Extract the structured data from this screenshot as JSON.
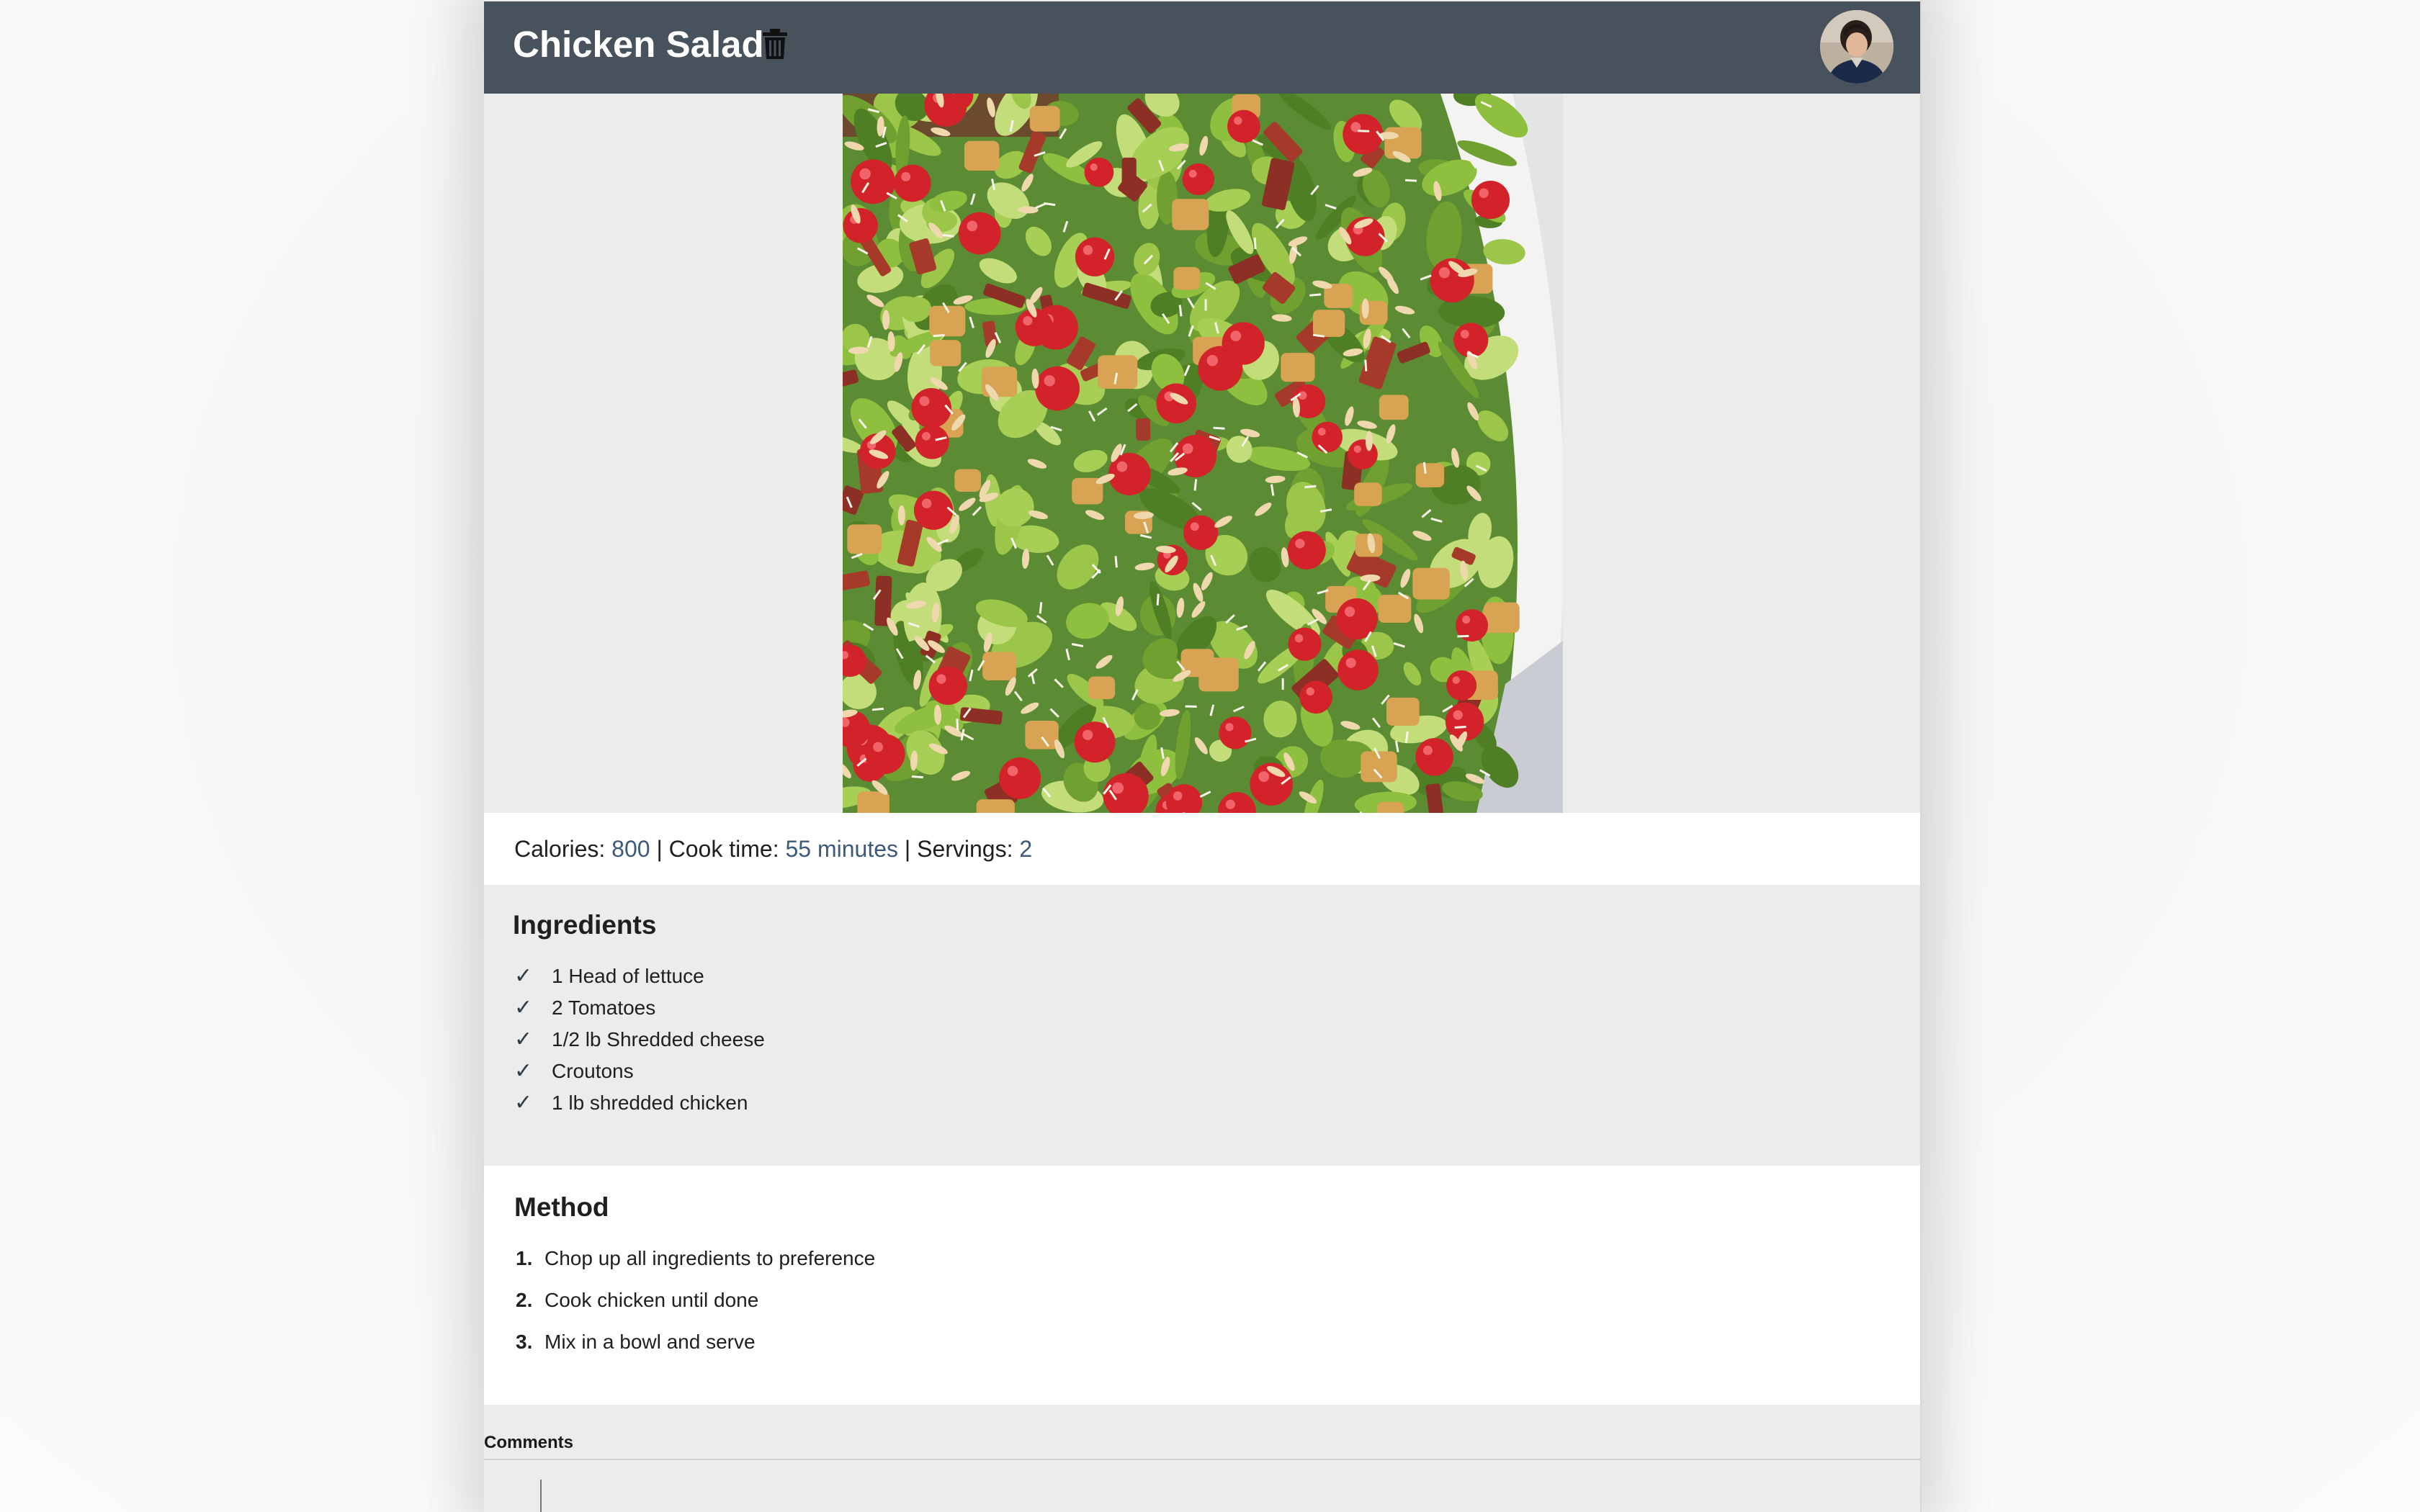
{
  "recipe": {
    "title": "Chicken Salad",
    "stats": {
      "calories_label": "Calories: ",
      "calories_value": "800",
      "separator": " | ",
      "cook_time_label": "Cook time: ",
      "cook_time_value": "55 minutes",
      "servings_label": "Servings: ",
      "servings_value": "2"
    },
    "ingredients": {
      "heading": "Ingredients",
      "check_glyph": "✓",
      "items": [
        "1 Head of lettuce",
        "2 Tomatoes",
        "1/2 lb Shredded cheese",
        "Croutons",
        "1 lb shredded chicken"
      ]
    },
    "method": {
      "heading": "Method",
      "steps": [
        {
          "num": "1.",
          "text": "Chop up all ingredients to preference"
        },
        {
          "num": "2.",
          "text": "Cook chicken until done"
        },
        {
          "num": "3.",
          "text": "Mix in a bowl and serve"
        }
      ]
    },
    "comments": {
      "label": "Comments"
    }
  },
  "icons": {
    "delete": "trash-icon",
    "profile": "user-avatar"
  },
  "colors": {
    "header_bg": "#47525d",
    "page_bg": "#ececec",
    "stat_value": "#3d5a7a"
  }
}
